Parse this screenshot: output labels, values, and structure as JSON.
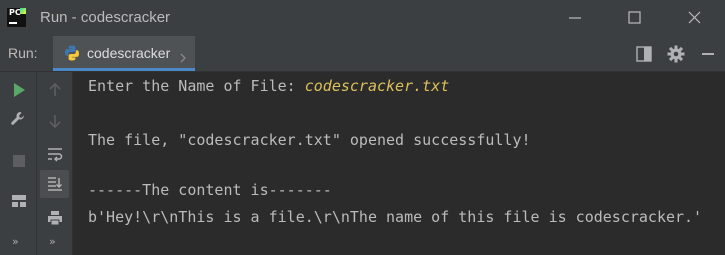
{
  "window": {
    "title": "Run - codescracker",
    "logo_text": "PC"
  },
  "run_panel": {
    "label": "Run:",
    "tab_label": "codescracker",
    "tab_close_glyph": "›",
    "icons": [
      "layout-icon",
      "gear-icon",
      "minimize-panel-icon"
    ]
  },
  "sidebar": {
    "left_icons": [
      "run-icon",
      "wrench-icon",
      "stop-icon",
      "layout-icon"
    ],
    "right_icons": [
      "up-arrow-icon",
      "down-arrow-icon",
      "soft-wrap-icon",
      "scroll-to-end-icon",
      "print-icon"
    ],
    "expand_glyph": "»"
  },
  "console": {
    "prompt": "Enter the Name of File: ",
    "user_input": "codescracker.txt",
    "success_line": "The file, \"codescracker.txt\" opened successfully!",
    "header_line": "------The content is-------",
    "content_line": "b'Hey!\\r\\nThis is a file.\\r\\nThe name of this file is codescracker.'"
  },
  "colors": {
    "console_bg": "#2b2b2b",
    "chrome_bg": "#3c3f41",
    "text": "#bbbbbb",
    "user_input": "#dcc05a",
    "tab_accent": "#4a88c7",
    "run_green": "#59a869"
  }
}
